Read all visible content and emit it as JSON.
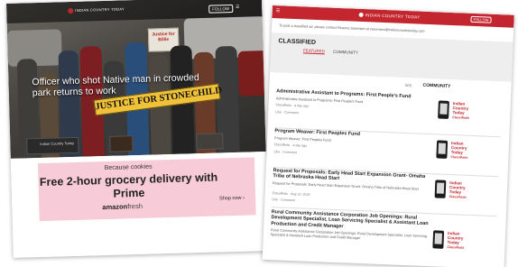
{
  "left_screen": {
    "site_logo": "INDIAN COUNTRY TODAY",
    "follow_label": "FOLLOW",
    "menu_label": "☰",
    "headline": "Officer who shot Native man in crowded park returns to work",
    "banner_text": "JUSTICE FOR STONECHILD",
    "sign_text": "Justice for Billie",
    "thumbnails": [
      {
        "text": "Indian Country Today"
      },
      {
        "text": ""
      },
      {
        "text": ""
      }
    ],
    "ad": {
      "small_text": "Because cookies",
      "headline": "Free 2-hour grocery delivery with Prime",
      "brand_main": "amazon",
      "brand_sub": "fresh",
      "cta": "Shop now ›",
      "background": "#f7cbd8"
    }
  },
  "right_screen": {
    "accent": "#c3262f",
    "site_logo": "INDIAN COUNTRY TODAY",
    "follow_label": "FOLLOW",
    "more_label": "☰",
    "note": "To post a classified ad, please contact Reanna Sorensen at rsorensen@indiancountrytoday.com",
    "section_title": "CLASSIFIED",
    "tabs": [
      "FEATURED",
      "COMMUNITY"
    ],
    "sidebar_sub": "SEE",
    "sidebar_title": "COMMUNITY",
    "listings": [
      {
        "title": "Administrative Assistant to Programs: First People's Fund",
        "desc": "Administrative Assistant to Programs: First People's Fund",
        "meta": "Classifieds · a day ago",
        "actions": "Like · Comment",
        "promo": "Indian Country Today",
        "promo_sub": "Classifieds"
      },
      {
        "title": "Program Weaver: First Peoples Fund",
        "desc": "Program Weaver: First Peoples Fund",
        "meta": "Classifieds · a day ago",
        "actions": "Like · Comment",
        "promo": "Indian Country Today",
        "promo_sub": "Classifieds"
      },
      {
        "title": "Request for Proposals: Early Head Start Expansion Grant- Omaha Tribe of Nebraska Head Start",
        "desc": "Request for Proposals: Early Head Start Expansion Grant- Omaha Tribe of Nebraska Head Start",
        "meta": "Classifieds · Aug 13, 2019",
        "actions": "Like · Comment",
        "promo": "Indian Country Today",
        "promo_sub": "Classifieds"
      },
      {
        "title": "Rural Community Assistance Corporation Job Openings: Rural Development Specialist, Loan Servicing Specialist & Assistant Loan Production and Credit Manager",
        "desc": "Rural Community Assistance Corporation Job Openings: Rural Development Specialist, Loan Servicing Specialist & Assistant Loan Production and Credit Manager",
        "meta": "",
        "actions": "",
        "promo": "Indian Country Today",
        "promo_sub": "Classifieds"
      }
    ]
  }
}
